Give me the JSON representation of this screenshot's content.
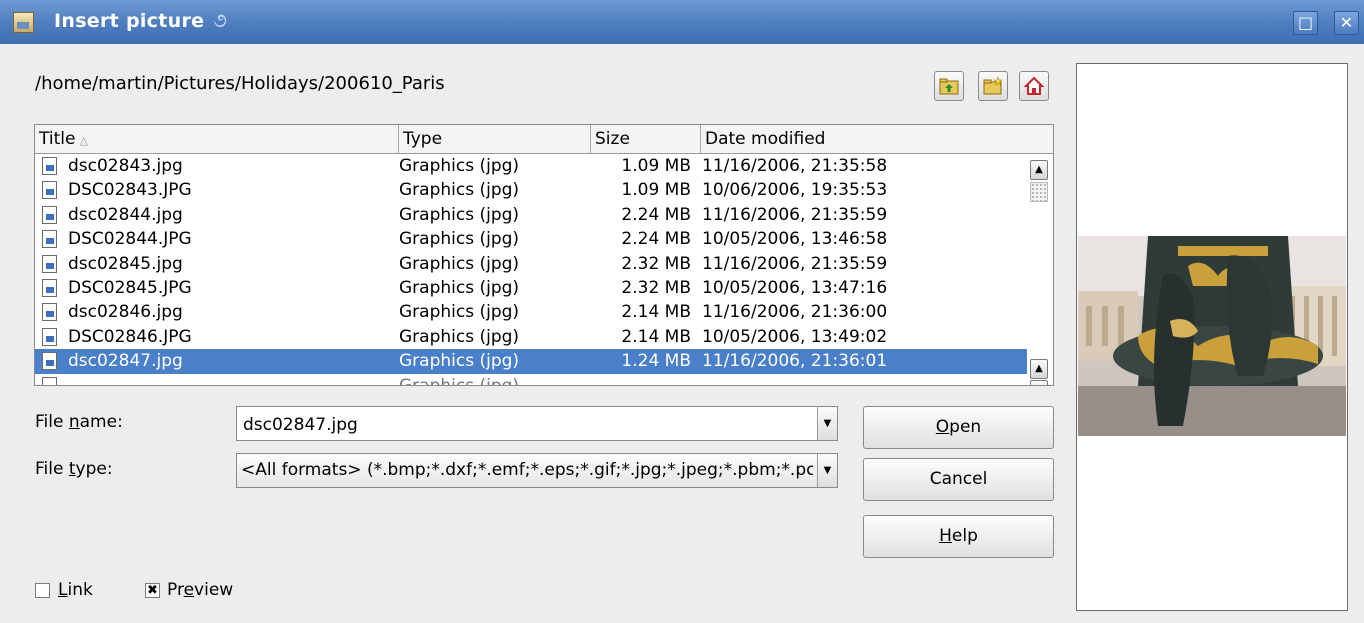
{
  "window": {
    "title": "Insert picture",
    "maximize_glyph": "□",
    "close_glyph": "✕"
  },
  "path": "/home/martin/Pictures/Holidays/200610_Paris",
  "toolbar": {
    "up_icon": "folder-up-icon",
    "new_folder_icon": "new-folder-icon",
    "home_icon": "home-icon"
  },
  "file_list": {
    "columns": {
      "title": "Title",
      "type": "Type",
      "size": "Size",
      "date": "Date modified"
    },
    "sort_indicator": "△",
    "rows": [
      {
        "name": "dsc02843.jpg",
        "type": "Graphics (jpg)",
        "size": "1.09 MB",
        "date": "11/16/2006, 21:35:58"
      },
      {
        "name": "DSC02843.JPG",
        "type": "Graphics (jpg)",
        "size": "1.09 MB",
        "date": "10/06/2006, 19:35:53"
      },
      {
        "name": "dsc02844.jpg",
        "type": "Graphics (jpg)",
        "size": "2.24 MB",
        "date": "11/16/2006, 21:35:59"
      },
      {
        "name": "DSC02844.JPG",
        "type": "Graphics (jpg)",
        "size": "2.24 MB",
        "date": "10/05/2006, 13:46:58"
      },
      {
        "name": "dsc02845.jpg",
        "type": "Graphics (jpg)",
        "size": "2.32 MB",
        "date": "11/16/2006, 21:35:59"
      },
      {
        "name": "DSC02845.JPG",
        "type": "Graphics (jpg)",
        "size": "2.32 MB",
        "date": "10/05/2006, 13:47:16"
      },
      {
        "name": "dsc02846.jpg",
        "type": "Graphics (jpg)",
        "size": "2.14 MB",
        "date": "11/16/2006, 21:36:00"
      },
      {
        "name": "DSC02846.JPG",
        "type": "Graphics (jpg)",
        "size": "2.14 MB",
        "date": "10/05/2006, 13:49:02"
      },
      {
        "name": "dsc02847.jpg",
        "type": "Graphics (jpg)",
        "size": "1.24 MB",
        "date": "11/16/2006, 21:36:01"
      }
    ],
    "selected_index": 8,
    "partial_row_type": "Graphics (jpg)"
  },
  "form": {
    "file_name_label_pre": "File ",
    "file_name_label_key": "n",
    "file_name_label_post": "ame:",
    "file_name_value": "dsc02847.jpg",
    "file_type_label_pre": "File ",
    "file_type_label_key": "t",
    "file_type_label_post": "ype:",
    "file_type_value": "<All formats> (*.bmp;*.dxf;*.emf;*.eps;*.gif;*.jpg;*.jpeg;*.pbm;*.pcd;*.pct;*.pcx;*.pgm;*.png;*.ppm;*.psd;*.ras;*.sgf;*.svm;*.tga;*.tif;*.tiff;*.wmf;*.xbm;*.xpm)"
  },
  "buttons": {
    "open_key": "O",
    "open_rest": "pen",
    "cancel": "Cancel",
    "help_key": "H",
    "help_rest": "elp"
  },
  "options": {
    "link_key": "L",
    "link_rest": "ink",
    "link_checked": false,
    "preview_pre": "Pr",
    "preview_key": "e",
    "preview_post": "view",
    "preview_checked": true,
    "checkmark": "✖"
  },
  "colors": {
    "titlebar": "#4f7fc1",
    "selection": "#4a7fc9"
  }
}
